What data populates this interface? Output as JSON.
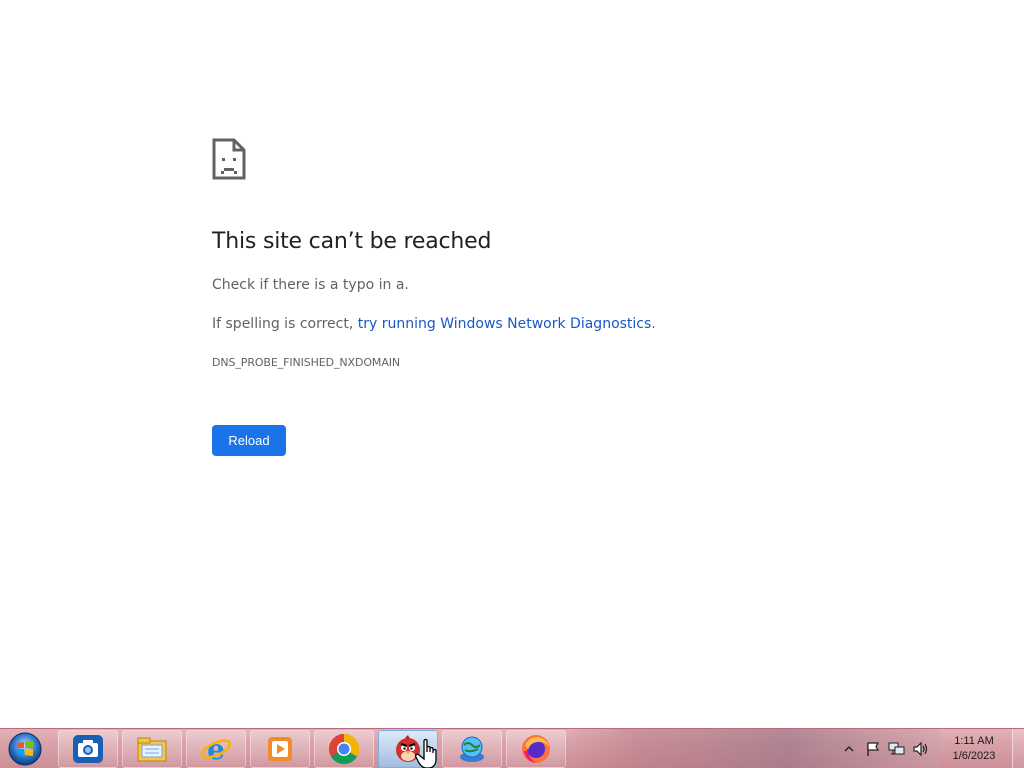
{
  "error_page": {
    "title": "This site can’t be reached",
    "check_text": "Check if there is a typo in a.",
    "spelling_prefix": "If spelling is correct, ",
    "diagnostics_link": "try running Windows Network Diagnostics",
    "spelling_suffix": ".",
    "error_code": "DNS_PROBE_FINISHED_NXDOMAIN",
    "reload_label": "Reload",
    "icon": "sad-page-icon",
    "accent_color": "#1a73e8",
    "link_color": "#1a57c6"
  },
  "taskbar": {
    "start_icon": "windows-start-orb-icon",
    "apps": [
      {
        "name": "camera-app-icon"
      },
      {
        "name": "file-explorer-icon"
      },
      {
        "name": "internet-explorer-icon"
      },
      {
        "name": "media-player-icon"
      },
      {
        "name": "chrome-icon"
      },
      {
        "name": "angry-birds-icon",
        "active": true
      },
      {
        "name": "globe-app-icon"
      },
      {
        "name": "firefox-icon"
      }
    ],
    "tray": {
      "icons": [
        "show-hidden-icons-icon",
        "action-center-flag-icon",
        "network-icon",
        "volume-icon"
      ],
      "time": "1:11 AM",
      "date": "1/6/2023"
    }
  }
}
